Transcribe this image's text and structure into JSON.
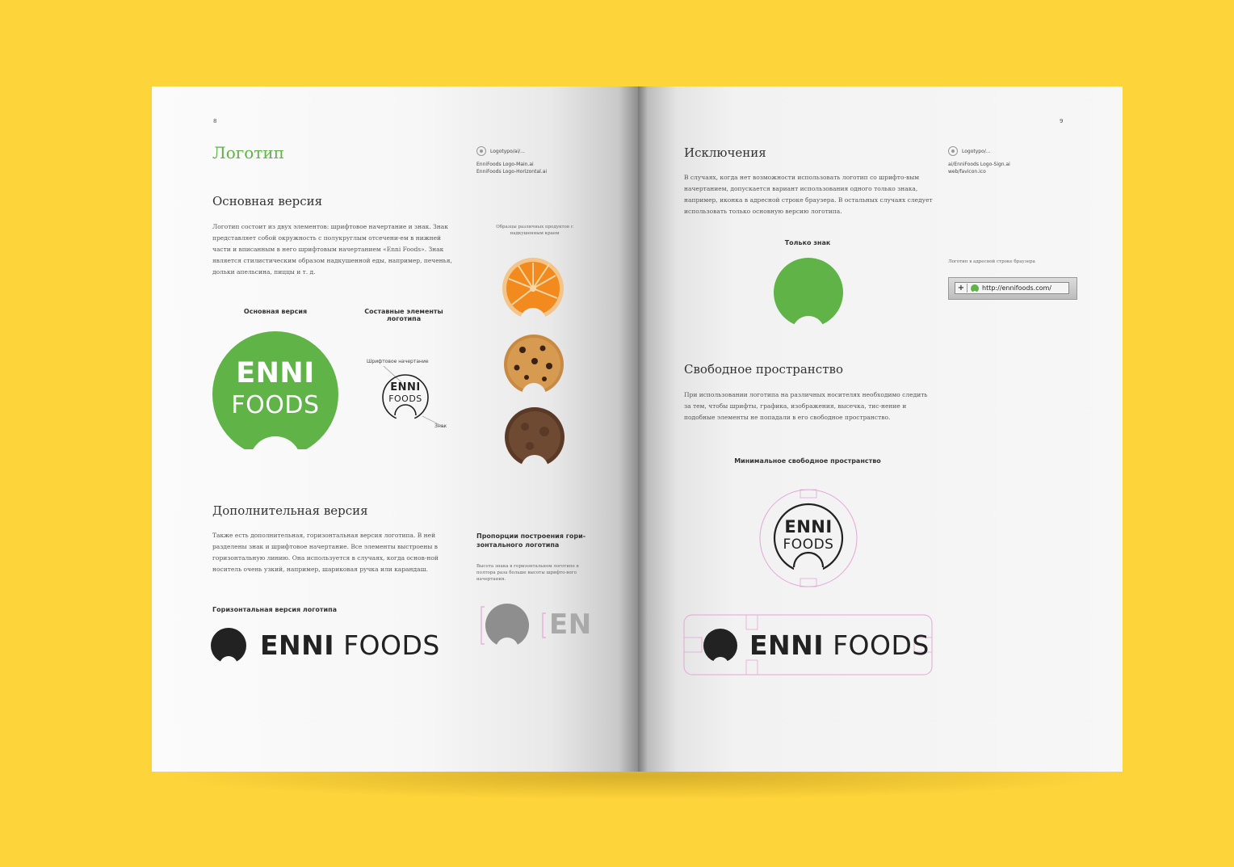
{
  "left": {
    "page_number": "8",
    "title": "Логотип",
    "file_path": "Logotypo/ai/...",
    "files": [
      "EnniFoods Logo-Main.ai",
      "EnniFoods Logo-Horizontal.ai"
    ],
    "section1_title": "Основная версия",
    "section1_body": "Логотип состоит из двух элементов: шрифтовое начертание и знак. Знак представляет собой окружность с полукруглым отсечени-ем в нижней части и вписанным в него шрифтовым начертанием «Enni Foods». Знак является стилистическим образом надкушенной еды, например, печенья, дольки апельсина, пиццы и т. д.",
    "products_caption": "Образцы различных продуктов с надкушенным краем",
    "main_version_caption": "Основная версия",
    "elements_caption": "Составные элементы логотипа",
    "font_label": "Шрифтовое начертание",
    "sign_label": "Знак",
    "logo_line1": "ENNI",
    "logo_line2": "FOODS",
    "section2_title": "Дополнительная версия",
    "section2_body": "Также есть дополнительная, горизонтальная версия логотипа. В ней разделены знак и шрифтовое начертание. Все элементы выстроены в горизонтальную линию. Она используется в случаях, когда основ-ной носитель очень узкий, например, шариковая ручка или карандаш.",
    "proportions_caption": "Пропорции построения гори-зонтального логотипа",
    "proportions_body": "Высота знака в горизонтальном логотипе в полтора раза больше высоты шрифто-вого начертания.",
    "horizontal_caption": "Горизонтальная версия логотипа",
    "wordmark_bold": "ENNI",
    "wordmark_light": "FOODS",
    "proportion_glyphs": "EN"
  },
  "right": {
    "page_number": "9",
    "title": "Исключения",
    "file_path": "Logotypo/...",
    "files": [
      "ai/EnniFoods Logo-Sign.ai",
      "web/favicon.ico"
    ],
    "exceptions_body": "В случаях, когда нет возможности использовать логотип со шрифто-вым начертанием, допускается вариант использования одного только знака, например, иконка в адресной строке браузера. В остальных случаях следует использовать только основную версию логотипа.",
    "sign_only_caption": "Только знак",
    "browser_caption": "Логотип в адресной строке браузера",
    "browser_url": "http://ennifoods.com/",
    "browser_plus": "+",
    "space_title": "Свободное пространство",
    "space_body": "При использовании логотипа на различных носителях необходимо следить за тем, чтобы шрифты, графика, изображения, высечка, тис-нение и подобные элементы не попадали в его свободное пространство.",
    "min_space_caption": "Минимальное свободное пространство",
    "logo_line1": "ENNI",
    "logo_line2": "FOODS",
    "wordmark_bold": "ENNI",
    "wordmark_light": "FOODS"
  },
  "colors": {
    "background": "#fdd43a",
    "brand_green": "#5fb347",
    "logo_dark": "#222222",
    "guide_pink": "#e6a6d6"
  }
}
